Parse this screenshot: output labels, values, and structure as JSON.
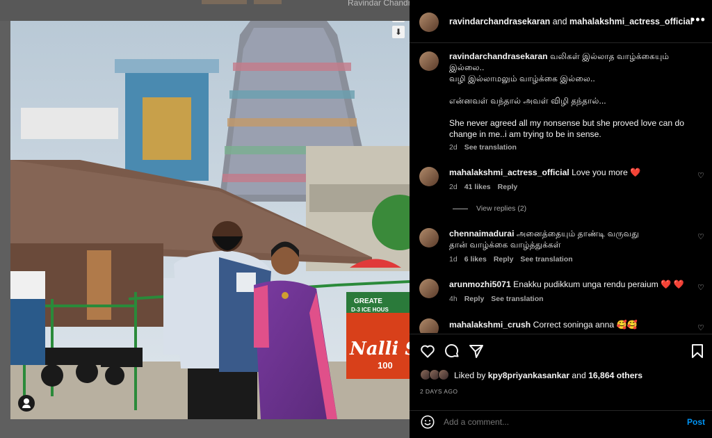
{
  "background": {
    "profile_name": "Ravindar Chandrasekaran"
  },
  "post": {
    "header": {
      "user1": "ravindarchandrasekaran",
      "connector": " and ",
      "user2": "mahalakshmi_actress_official",
      "more_icon": "more-horizontal-icon"
    },
    "caption": {
      "username": "ravindarchandrasekaran",
      "line1": " வலிகள் இல்லாத வாழ்க்கையும்",
      "line2": "இல்லை..",
      "line3": "வழி இல்லாமலும் வாழ்க்கை இல்லை..",
      "line4": "என்னவள் வந்தால் அவள் விழி தந்தால்...",
      "line5": "She never agreed all my nonsense but she proved love can do",
      "line6": "change in me..i am trying to be in sense.",
      "time": "2d",
      "translate": "See translation"
    },
    "comments": [
      {
        "username": "mahalakshmi_actress_official",
        "text": " Love you more ",
        "emoji": "❤️",
        "time": "2d",
        "likes": "41 likes",
        "reply": "Reply",
        "view_replies": "View replies (2)"
      },
      {
        "username": "chennaimadurai",
        "text": " அனைத்தையும் தாண்டி வருவது",
        "text2": "தான் வாழ்க்கை வாழ்த்துக்கள்",
        "time": "1d",
        "likes": "6 likes",
        "reply": "Reply",
        "translate": "See translation"
      },
      {
        "username": "arunmozhi5071",
        "text": " Enakku pudikkum unga rendu peraium ",
        "emoji": "❤️ ❤️",
        "time": "4h",
        "reply": "Reply",
        "translate": "See translation"
      },
      {
        "username": "mahalakshmi_crush",
        "text": " Correct soninga anna ",
        "emoji": "🥰🥰"
      }
    ],
    "actions": {
      "liked_prefix": "Liked by ",
      "liked_user": "kpy8priyankasankar",
      "liked_mid": " and ",
      "liked_count": "16,864 others",
      "date": "2 DAYS AGO"
    },
    "add_comment": {
      "placeholder": "Add a comment...",
      "post_label": "Post"
    },
    "photo_signs": {
      "ice_house": "GREATE",
      "ice_house2": "D-3 ICE HOUS",
      "nalli": "Nalli S",
      "nalli_num": "100"
    }
  },
  "colors": {
    "panel_bg": "#000000",
    "link_blue": "#0095f6",
    "heart_red": "#e0245e"
  }
}
